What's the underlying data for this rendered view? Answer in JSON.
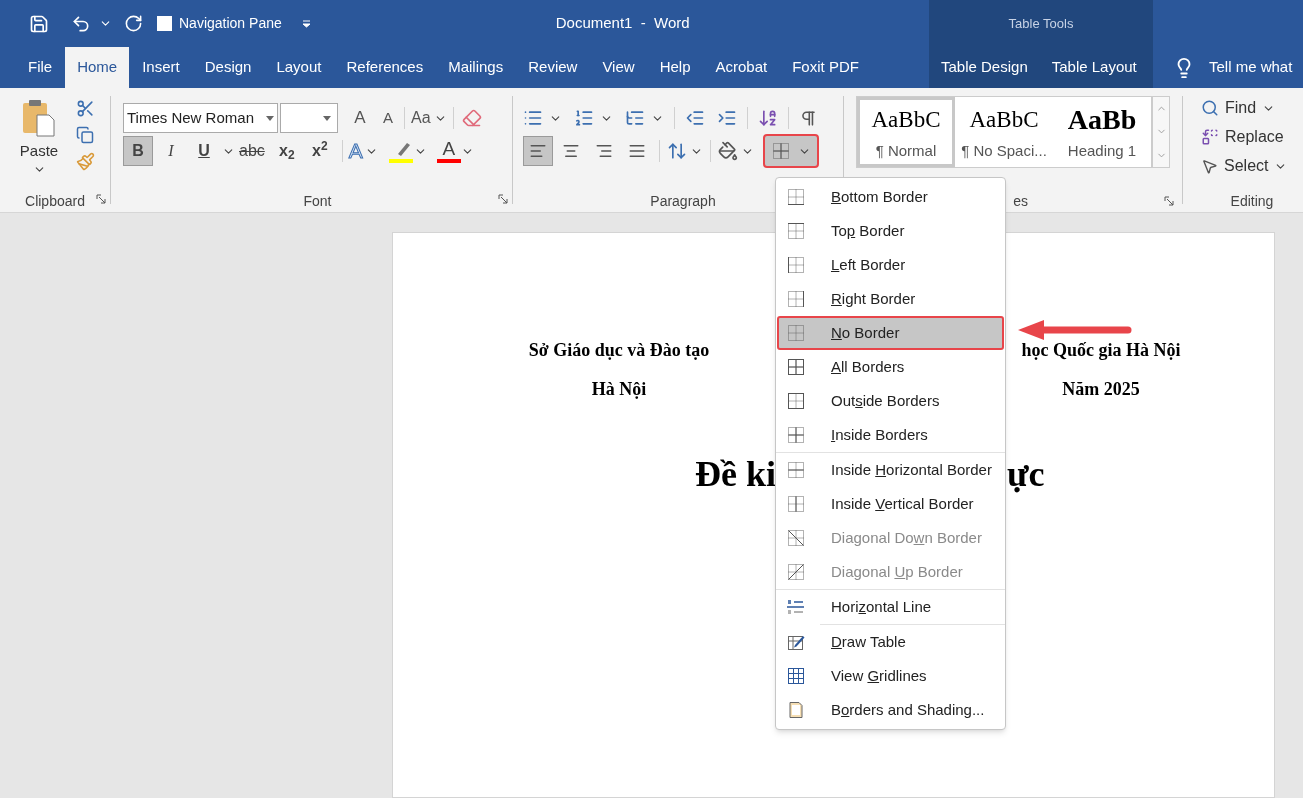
{
  "title_bar": {
    "navigation_pane": {
      "label": "Navigation Pane",
      "checked": false
    },
    "title": "Document1  -  Word",
    "context_title": "Table Tools"
  },
  "tabs": [
    {
      "label": "File",
      "selected": false,
      "contextual": false
    },
    {
      "label": "Home",
      "selected": true,
      "contextual": false
    },
    {
      "label": "Insert",
      "selected": false,
      "contextual": false
    },
    {
      "label": "Design",
      "selected": false,
      "contextual": false
    },
    {
      "label": "Layout",
      "selected": false,
      "contextual": false
    },
    {
      "label": "References",
      "selected": false,
      "contextual": false
    },
    {
      "label": "Mailings",
      "selected": false,
      "contextual": false
    },
    {
      "label": "Review",
      "selected": false,
      "contextual": false
    },
    {
      "label": "View",
      "selected": false,
      "contextual": false
    },
    {
      "label": "Help",
      "selected": false,
      "contextual": false
    },
    {
      "label": "Acrobat",
      "selected": false,
      "contextual": false
    },
    {
      "label": "Foxit PDF",
      "selected": false,
      "contextual": false
    },
    {
      "label": "Table Design",
      "selected": false,
      "contextual": true
    },
    {
      "label": "Table Layout",
      "selected": false,
      "contextual": true
    }
  ],
  "tell_me": "Tell me what",
  "ribbon": {
    "clipboard": {
      "label": "Clipboard",
      "paste": "Paste"
    },
    "font": {
      "label": "Font",
      "font_name": "Times New Roman",
      "case": "Aa",
      "buttons": [
        {
          "kind": "bold",
          "text": "B",
          "selected": true
        },
        {
          "kind": "italic",
          "text": "I",
          "selected": false
        },
        {
          "kind": "underline",
          "text": "U",
          "selected": false
        },
        {
          "kind": "strike",
          "text": "abc",
          "selected": false
        },
        {
          "kind": "sub",
          "text": "x$_{2}$",
          "selected": false
        },
        {
          "kind": "super",
          "text": "x$^{2}$",
          "selected": false
        }
      ],
      "grow": "A",
      "shrink": "A",
      "effects": "A",
      "font_color_letter": "A"
    },
    "paragraph": {
      "label": "Paragraph",
      "alignment": [
        {
          "kind": "left",
          "selected": true
        },
        {
          "kind": "center",
          "selected": false
        },
        {
          "kind": "right",
          "selected": false
        },
        {
          "kind": "justify",
          "selected": false
        }
      ],
      "borders_open": true,
      "borders_highlighted": true
    },
    "styles": {
      "label": "es",
      "items": [
        {
          "preview": "AaBbC",
          "name": "¶ Normal",
          "kind": "normal",
          "selected": true
        },
        {
          "preview": "AaBbC",
          "name": "¶ No Spaci...",
          "kind": "normal",
          "selected": false
        },
        {
          "preview": "AaBb",
          "name": "Heading 1",
          "kind": "heading",
          "selected": false
        }
      ]
    },
    "editing": {
      "label": "Editing",
      "find": "Find",
      "replace": "Replace",
      "select": "Select"
    }
  },
  "document": {
    "left_header": [
      "Sở Giáo dục và Đào tạo",
      "Hà Nội"
    ],
    "right_header": [
      "học Quốc gia Hà Nội",
      "Năm 2025"
    ],
    "title_left": "Đề ki",
    "title_right": "ực"
  },
  "borders_menu": {
    "groups": [
      [
        {
          "kind": "bottom",
          "key": "B",
          "after": "ottom Border",
          "disabled": false,
          "selected": false
        },
        {
          "kind": "top",
          "before": "To",
          "key": "p",
          "after": " Border",
          "disabled": false,
          "selected": false
        },
        {
          "kind": "left",
          "key": "L",
          "after": "eft Border",
          "disabled": false,
          "selected": false
        },
        {
          "kind": "right",
          "key": "R",
          "after": "ight Border",
          "disabled": false,
          "selected": false
        },
        {
          "kind": "none",
          "key": "N",
          "after": "o Border",
          "disabled": false,
          "selected": true
        },
        {
          "kind": "all",
          "key": "A",
          "after": "ll Borders",
          "disabled": false,
          "selected": false
        },
        {
          "kind": "outside",
          "before": "Out",
          "key": "s",
          "after": "ide Borders",
          "disabled": false,
          "selected": false
        },
        {
          "kind": "inside",
          "key": "I",
          "after": "nside Borders",
          "disabled": false,
          "selected": false
        }
      ],
      [
        {
          "kind": "inside-h",
          "before": "Inside ",
          "key": "H",
          "after": "orizontal Border",
          "disabled": false,
          "selected": false
        },
        {
          "kind": "inside-v",
          "before": "Inside ",
          "key": "V",
          "after": "ertical Border",
          "disabled": false,
          "selected": false
        },
        {
          "kind": "diag-down",
          "before": "Diagonal Do",
          "key": "w",
          "after": "n Border",
          "disabled": true,
          "selected": false
        },
        {
          "kind": "diag-up",
          "before": "Diagonal ",
          "key": "U",
          "after": "p Border",
          "disabled": true,
          "selected": false
        }
      ],
      [
        {
          "kind": "hline",
          "before": "Hori",
          "key": "z",
          "after": "ontal Line",
          "disabled": false,
          "selected": false
        }
      ],
      [
        {
          "kind": "draw",
          "key": "D",
          "after": "raw Table",
          "disabled": false,
          "selected": false
        },
        {
          "kind": "grid",
          "before": "View ",
          "key": "G",
          "after": "ridlines",
          "disabled": false,
          "selected": false
        },
        {
          "kind": "shading",
          "before": "B",
          "key": "o",
          "after": "rders and Shading...",
          "disabled": false,
          "selected": false
        }
      ]
    ]
  }
}
